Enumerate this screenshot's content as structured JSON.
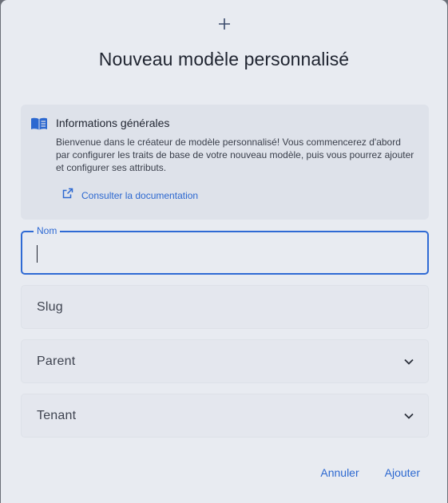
{
  "dialog": {
    "title": "Nouveau modèle personnalisé",
    "header_icon": "plus-icon"
  },
  "info": {
    "icon": "book-open-icon",
    "title": "Informations générales",
    "body": "Bienvenue dans le créateur de modèle personnalisé! Vous commencerez d'abord par configurer les traits de base de votre nouveau modèle, puis vous pourrez ajouter et configurer ses attributs.",
    "link_icon": "external-link-icon",
    "link_label": "Consulter la documentation"
  },
  "form": {
    "nom": {
      "label": "Nom",
      "value": ""
    },
    "slug": {
      "label": "Slug",
      "value": ""
    },
    "parent": {
      "label": "Parent",
      "value": ""
    },
    "tenant": {
      "label": "Tenant",
      "value": ""
    }
  },
  "actions": {
    "cancel_label": "Annuler",
    "add_label": "Ajouter"
  },
  "colors": {
    "accent": "#2f6ad4",
    "dialog_bg": "#e8ebf1",
    "card_bg": "#dee2ea"
  }
}
